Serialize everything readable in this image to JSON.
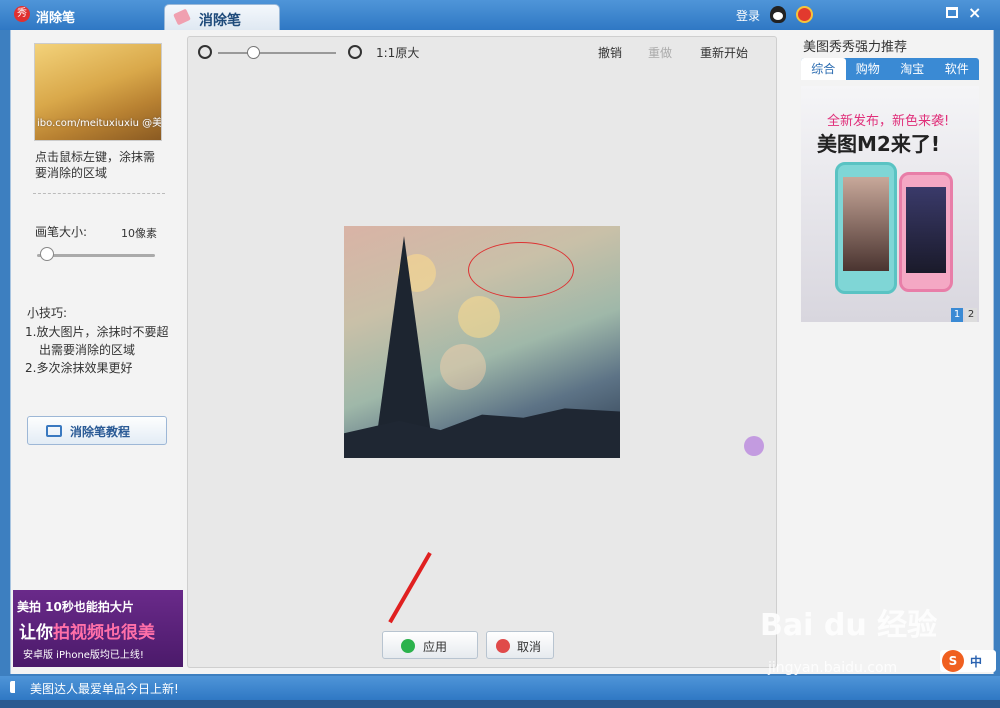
{
  "titlebar": {
    "app_logo": "秀",
    "app_title": "消除笔",
    "tab_label": "消除笔",
    "login": "登录",
    "close": "×"
  },
  "left": {
    "thumb_watermark": "ibo.com/meituxiuxiu @美图秀秀",
    "hint": "点击鼠标左键，涂抹需要消除的区域",
    "brush_label": "画笔大小:",
    "brush_value": "10像素",
    "brush_level": 0.05,
    "tips_title": "小技巧:",
    "tips": [
      "1.放大图片，涂抹时不要超出需要消除的区域",
      "2.多次涂抹效果更好"
    ],
    "tutorial_label": "消除笔教程",
    "ad_line1": "美拍 10秒也能拍大片",
    "ad_line2a": "让你",
    "ad_line2b": "拍视频也很美",
    "ad_line3": "安卓版  iPhone版均已上线!"
  },
  "center": {
    "orig_label": "1:1原大",
    "undo": "撤销",
    "redo": "重做",
    "reset": "重新开始",
    "zoom_level": 0.3,
    "apply": "应用",
    "cancel": "取消"
  },
  "right": {
    "rec_title": "美图秀秀强力推荐",
    "tabs": [
      "综合",
      "购物",
      "淘宝",
      "软件"
    ],
    "ad_line1": "全新发布，新色来袭!",
    "ad_line2": "美图M2来了!",
    "pages": [
      "1",
      "2"
    ]
  },
  "watermark": {
    "text": "Bai du 经验",
    "url": "jingyan.baidu.com"
  },
  "ime": {
    "s": "S",
    "label": "中"
  },
  "status": {
    "text": "美图达人最爱单品今日上新!"
  }
}
